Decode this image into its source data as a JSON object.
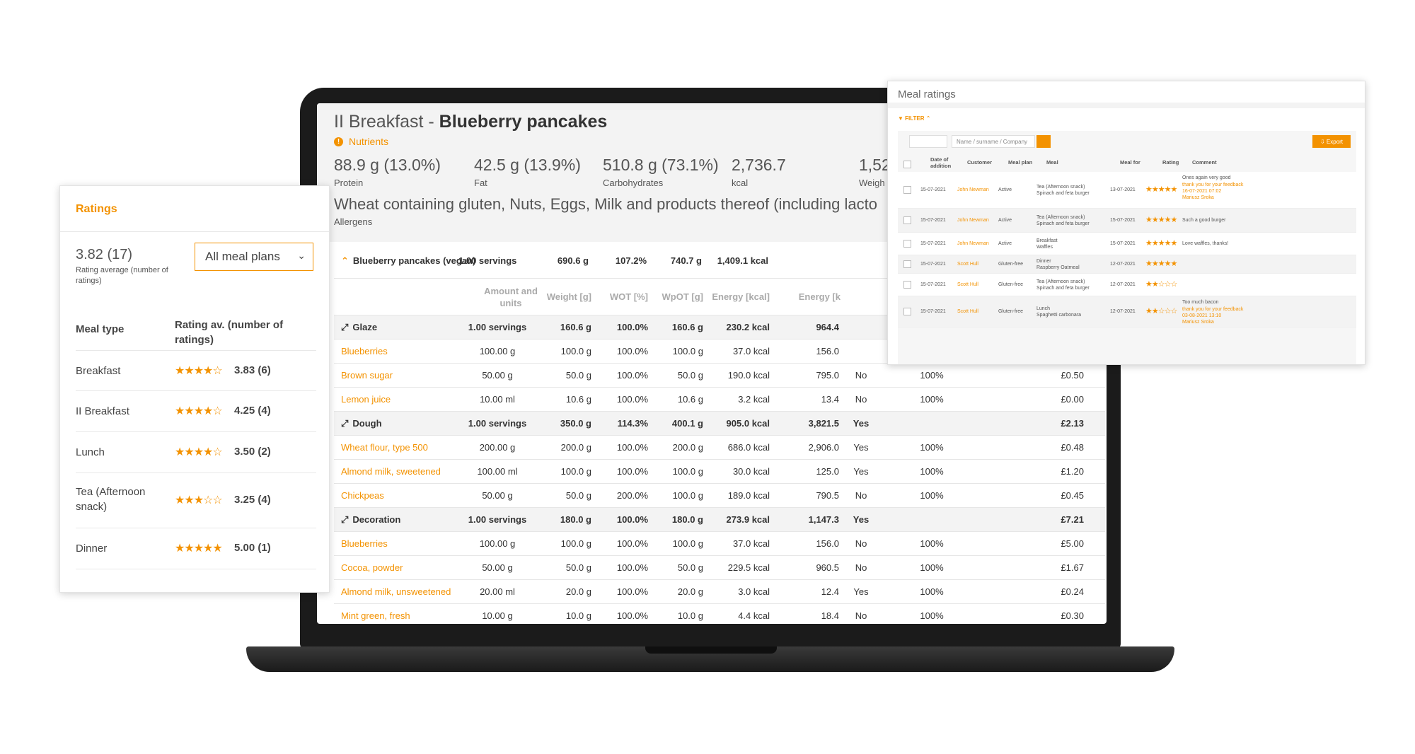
{
  "colors": {
    "accent": "#f39200"
  },
  "main": {
    "title_prefix": "II Breakfast - ",
    "title_meal": "Blueberry pancakes",
    "nutrients_label": "Nutrients",
    "nutrients": [
      {
        "value": "88.9 g (13.0%)",
        "label": "Protein"
      },
      {
        "value": "42.5 g (13.9%)",
        "label": "Fat"
      },
      {
        "value": "510.8 g (73.1%)",
        "label": "Carbohydrates"
      },
      {
        "value": "2,736.7",
        "label": "kcal"
      },
      {
        "value": "1,52",
        "label": "Weigh"
      }
    ],
    "allergens": "Wheat containing gluten, Nuts, Eggs, Milk and products thereof (including lacto",
    "allergens_label": "Allergens",
    "recipe_row": {
      "name": "Blueberry pancakes (vegan)",
      "servings": "1.00 servings",
      "weight": "690.6 g",
      "wot": "107.2%",
      "wpot": "740.7 g",
      "energy": "1,409.1 kcal"
    },
    "columns": [
      "Amount and units",
      "Weight [g]",
      "WOT [%]",
      "WpOT [g]",
      "Energy [kcal]",
      "Energy [k"
    ],
    "rows": [
      {
        "type": "grp",
        "name": "Glaze",
        "amount": "1.00 servings",
        "weight": "160.6 g",
        "wot": "100.0%",
        "wpot": "160.6 g",
        "kcal": "230.2 kcal",
        "kj": "964.4",
        "flag": "",
        "pct": "",
        "cost": ""
      },
      {
        "type": "ing",
        "name": "Blueberries",
        "amount": "100.00 g",
        "weight": "100.0 g",
        "wot": "100.0%",
        "wpot": "100.0 g",
        "kcal": "37.0 kcal",
        "kj": "156.0",
        "flag": "",
        "pct": "",
        "cost": ""
      },
      {
        "type": "ing",
        "name": "Brown sugar",
        "amount": "50.00 g",
        "weight": "50.0 g",
        "wot": "100.0%",
        "wpot": "50.0 g",
        "kcal": "190.0 kcal",
        "kj": "795.0",
        "flag": "No",
        "pct": "100%",
        "cost": "£0.50"
      },
      {
        "type": "ing",
        "name": "Lemon juice",
        "amount": "10.00 ml",
        "weight": "10.6 g",
        "wot": "100.0%",
        "wpot": "10.6 g",
        "kcal": "3.2 kcal",
        "kj": "13.4",
        "flag": "No",
        "pct": "100%",
        "cost": "£0.00"
      },
      {
        "type": "grp",
        "name": "Dough",
        "amount": "1.00 servings",
        "weight": "350.0 g",
        "wot": "114.3%",
        "wpot": "400.1 g",
        "kcal": "905.0 kcal",
        "kj": "3,821.5",
        "flag": "Yes",
        "pct": "",
        "cost": "£2.13"
      },
      {
        "type": "ing",
        "name": "Wheat flour, type 500",
        "amount": "200.00 g",
        "weight": "200.0 g",
        "wot": "100.0%",
        "wpot": "200.0 g",
        "kcal": "686.0 kcal",
        "kj": "2,906.0",
        "flag": "Yes",
        "pct": "100%",
        "cost": "£0.48"
      },
      {
        "type": "ing",
        "name": "Almond milk, sweetened",
        "amount": "100.00 ml",
        "weight": "100.0 g",
        "wot": "100.0%",
        "wpot": "100.0 g",
        "kcal": "30.0 kcal",
        "kj": "125.0",
        "flag": "Yes",
        "pct": "100%",
        "cost": "£1.20"
      },
      {
        "type": "ing",
        "name": "Chickpeas",
        "amount": "50.00 g",
        "weight": "50.0 g",
        "wot": "200.0%",
        "wpot": "100.0 g",
        "kcal": "189.0 kcal",
        "kj": "790.5",
        "flag": "No",
        "pct": "100%",
        "cost": "£0.45"
      },
      {
        "type": "grp",
        "name": "Decoration",
        "amount": "1.00 servings",
        "weight": "180.0 g",
        "wot": "100.0%",
        "wpot": "180.0 g",
        "kcal": "273.9 kcal",
        "kj": "1,147.3",
        "flag": "Yes",
        "pct": "",
        "cost": "£7.21"
      },
      {
        "type": "ing",
        "name": "Blueberries",
        "amount": "100.00 g",
        "weight": "100.0 g",
        "wot": "100.0%",
        "wpot": "100.0 g",
        "kcal": "37.0 kcal",
        "kj": "156.0",
        "flag": "No",
        "pct": "100%",
        "cost": "£5.00"
      },
      {
        "type": "ing",
        "name": "Cocoa, powder",
        "amount": "50.00 g",
        "weight": "50.0 g",
        "wot": "100.0%",
        "wpot": "50.0 g",
        "kcal": "229.5 kcal",
        "kj": "960.5",
        "flag": "No",
        "pct": "100%",
        "cost": "£1.67"
      },
      {
        "type": "ing",
        "name": "Almond milk, unsweetened",
        "amount": "20.00 ml",
        "weight": "20.0 g",
        "wot": "100.0%",
        "wpot": "20.0 g",
        "kcal": "3.0 kcal",
        "kj": "12.4",
        "flag": "Yes",
        "pct": "100%",
        "cost": "£0.24"
      },
      {
        "type": "ing",
        "name": "Mint green, fresh",
        "amount": "10.00 g",
        "weight": "10.0 g",
        "wot": "100.0%",
        "wpot": "10.0 g",
        "kcal": "4.4 kcal",
        "kj": "18.4",
        "flag": "No",
        "pct": "100%",
        "cost": "£0.30"
      }
    ]
  },
  "ratings": {
    "title": "Ratings",
    "average": "3.82 (17)",
    "average_label": "Rating average (number of ratings)",
    "select_value": "All meal plans",
    "col_meal_type": "Meal type",
    "col_rating": "Rating av. (number of ratings)",
    "rows": [
      {
        "meal": "Breakfast",
        "stars": "★★★★☆",
        "score": "3.83 (6)"
      },
      {
        "meal": "II Breakfast",
        "stars": "★★★★☆",
        "score": "4.25 (4)"
      },
      {
        "meal": "Lunch",
        "stars": "★★★★☆",
        "score": "3.50 (2)"
      },
      {
        "meal": "Tea (Afternoon snack)",
        "stars": "★★★☆☆",
        "score": "3.25 (4)"
      },
      {
        "meal": "Dinner",
        "stars": "★★★★★",
        "score": "5.00 (1)"
      }
    ]
  },
  "meal_ratings": {
    "title": "Meal ratings",
    "filter_label": "FILTER",
    "search_placeholder": "Name / surname / Company",
    "export_label": "Export",
    "columns": [
      "Date of addition",
      "Customer",
      "Meal plan",
      "Meal",
      "Meal for",
      "Rating",
      "Comment"
    ],
    "rows": [
      {
        "date": "15-07-2021",
        "customer": "John Newman",
        "plan": "Active",
        "meal1": "Tea (Afternoon snack)",
        "meal2": "Spinach and feta burger",
        "meal_for": "13-07-2021",
        "stars": "★★★★★",
        "comment": "Ones again very good",
        "reply": "thank you for your feedback",
        "reply_date": "16-07-2021 07:02",
        "reply_by": "Mariusz Sroka"
      },
      {
        "date": "15-07-2021",
        "customer": "John Newman",
        "plan": "Active",
        "meal1": "Tea (Afternoon snack)",
        "meal2": "Spinach and feta burger",
        "meal_for": "15-07-2021",
        "stars": "★★★★★",
        "comment": "Such a good burger",
        "reply": "",
        "reply_date": "",
        "reply_by": ""
      },
      {
        "date": "15-07-2021",
        "customer": "John Newman",
        "plan": "Active",
        "meal1": "Breakfast",
        "meal2": "Waffles",
        "meal_for": "15-07-2021",
        "stars": "★★★★★",
        "comment": "Love waffles, thanks!",
        "reply": "",
        "reply_date": "",
        "reply_by": ""
      },
      {
        "date": "15-07-2021",
        "customer": "Scott Hull",
        "plan": "Gluten-free",
        "meal1": "Dinner",
        "meal2": "Raspberry Oatmeal",
        "meal_for": "12-07-2021",
        "stars": "★★★★★",
        "comment": "",
        "reply": "",
        "reply_date": "",
        "reply_by": ""
      },
      {
        "date": "15-07-2021",
        "customer": "Scott Hull",
        "plan": "Gluten-free",
        "meal1": "Tea (Afternoon snack)",
        "meal2": "Spinach and feta burger",
        "meal_for": "12-07-2021",
        "stars": "★★☆☆☆",
        "comment": "",
        "reply": "",
        "reply_date": "",
        "reply_by": ""
      },
      {
        "date": "15-07-2021",
        "customer": "Scott Hull",
        "plan": "Gluten-free",
        "meal1": "Lunch",
        "meal2": "Spaghetti carbonara",
        "meal_for": "12-07-2021",
        "stars": "★★☆☆☆",
        "comment": "Too much bacon",
        "reply": "thank you for your feedback",
        "reply_date": "03-08-2021 13:10",
        "reply_by": "Mariusz Sroka"
      }
    ]
  }
}
